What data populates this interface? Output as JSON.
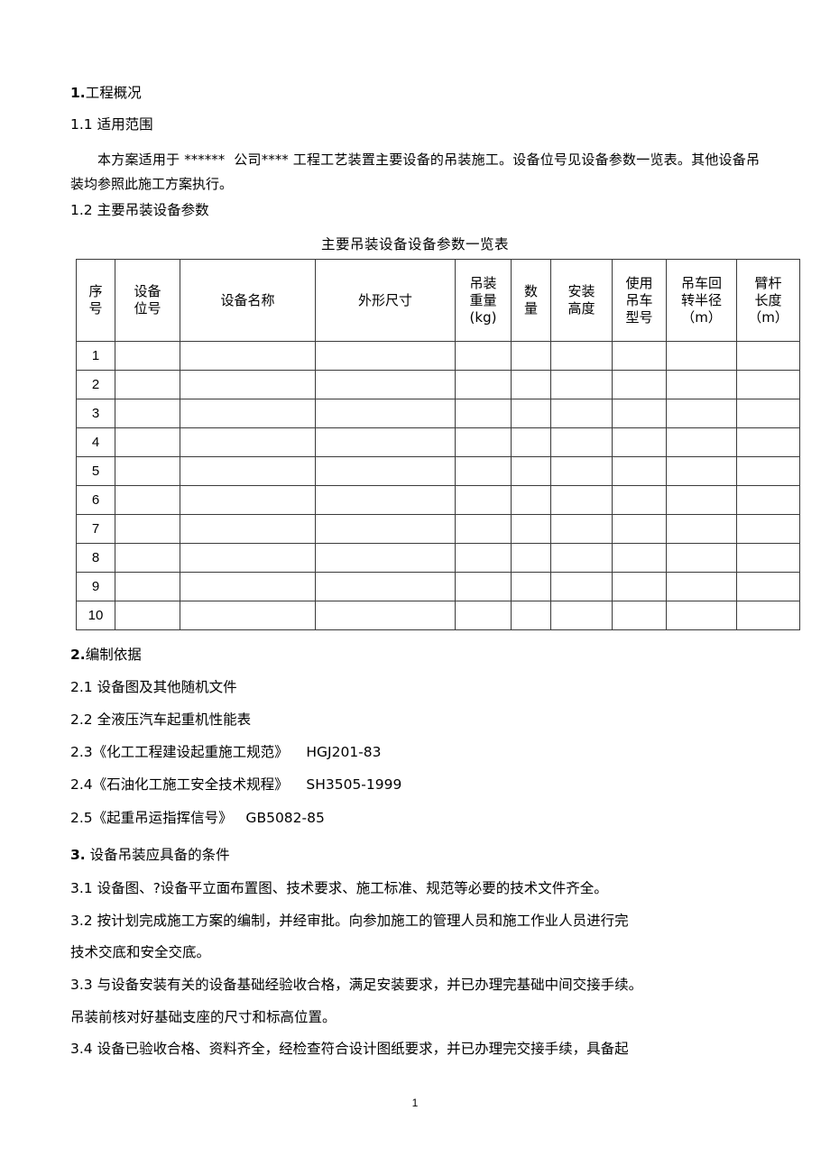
{
  "document": {
    "page_number": "1"
  },
  "section1": {
    "number": "1.",
    "title": "工程概况",
    "sub1_label": "1.1 适用范围",
    "sub1_paragraph": "本方案适用于 ******  公司**** 工程工艺装置主要设备的吊装施工。设备位号见设备参数一览表。其他设备吊装均参照此施工方案执行。",
    "sub2_label": "1.2 主要吊装设备参数"
  },
  "table": {
    "caption": "主要吊装设备设备参数一览表",
    "headers": [
      "序\n号",
      "设备\n位号",
      "设备名称",
      "外形尺寸",
      "吊装\n重量\n(kg)",
      "数\n量",
      "安装\n高度",
      "使用\n吊车\n型号",
      "吊车回\n转半径\n（m）",
      "臂杆\n长度\n（m）"
    ],
    "rows": [
      {
        "index": "1",
        "cells": [
          "",
          "",
          "",
          "",
          "",
          "",
          "",
          "",
          ""
        ]
      },
      {
        "index": "2",
        "cells": [
          "",
          "",
          "",
          "",
          "",
          "",
          "",
          "",
          ""
        ]
      },
      {
        "index": "3",
        "cells": [
          "",
          "",
          "",
          "",
          "",
          "",
          "",
          "",
          ""
        ]
      },
      {
        "index": "4",
        "cells": [
          "",
          "",
          "",
          "",
          "",
          "",
          "",
          "",
          ""
        ]
      },
      {
        "index": "5",
        "cells": [
          "",
          "",
          "",
          "",
          "",
          "",
          "",
          "",
          ""
        ]
      },
      {
        "index": "6",
        "cells": [
          "",
          "",
          "",
          "",
          "",
          "",
          "",
          "",
          ""
        ]
      },
      {
        "index": "7",
        "cells": [
          "",
          "",
          "",
          "",
          "",
          "",
          "",
          "",
          ""
        ]
      },
      {
        "index": "8",
        "cells": [
          "",
          "",
          "",
          "",
          "",
          "",
          "",
          "",
          ""
        ]
      },
      {
        "index": "9",
        "cells": [
          "",
          "",
          "",
          "",
          "",
          "",
          "",
          "",
          ""
        ]
      },
      {
        "index": "10",
        "cells": [
          "",
          "",
          "",
          "",
          "",
          "",
          "",
          "",
          ""
        ]
      }
    ]
  },
  "section2": {
    "number": "2.",
    "title": "编制依据",
    "items": [
      "2.1 设备图及其他随机文件",
      "2.2 全液压汽车起重机性能表",
      "2.3《化工工程建设起重施工规范》    HGJ201-83",
      "2.4《石油化工施工安全技术规程》    SH3505-1999",
      "2.5《起重吊运指挥信号》   GB5082-85"
    ]
  },
  "section3": {
    "number": "3.",
    "title": " 设备吊装应具备的条件",
    "items": [
      "3.1 设备图、?设备平立面布置图、技术要求、施工标准、规范等必要的技术文件齐全。",
      "3.2 按计划完成施工方案的编制，并经审批。向参加施工的管理人员和施工作业人员进行完",
      "技术交底和安全交底。",
      "3.3 与设备安装有关的设备基础经验收合格，满足安装要求，并已办理完基础中间交接手续。",
      "吊装前核对好基础支座的尺寸和标高位置。",
      "3.4 设备已验收合格、资料齐全，经检查符合设计图纸要求，并已办理完交接手续，具备起"
    ]
  }
}
